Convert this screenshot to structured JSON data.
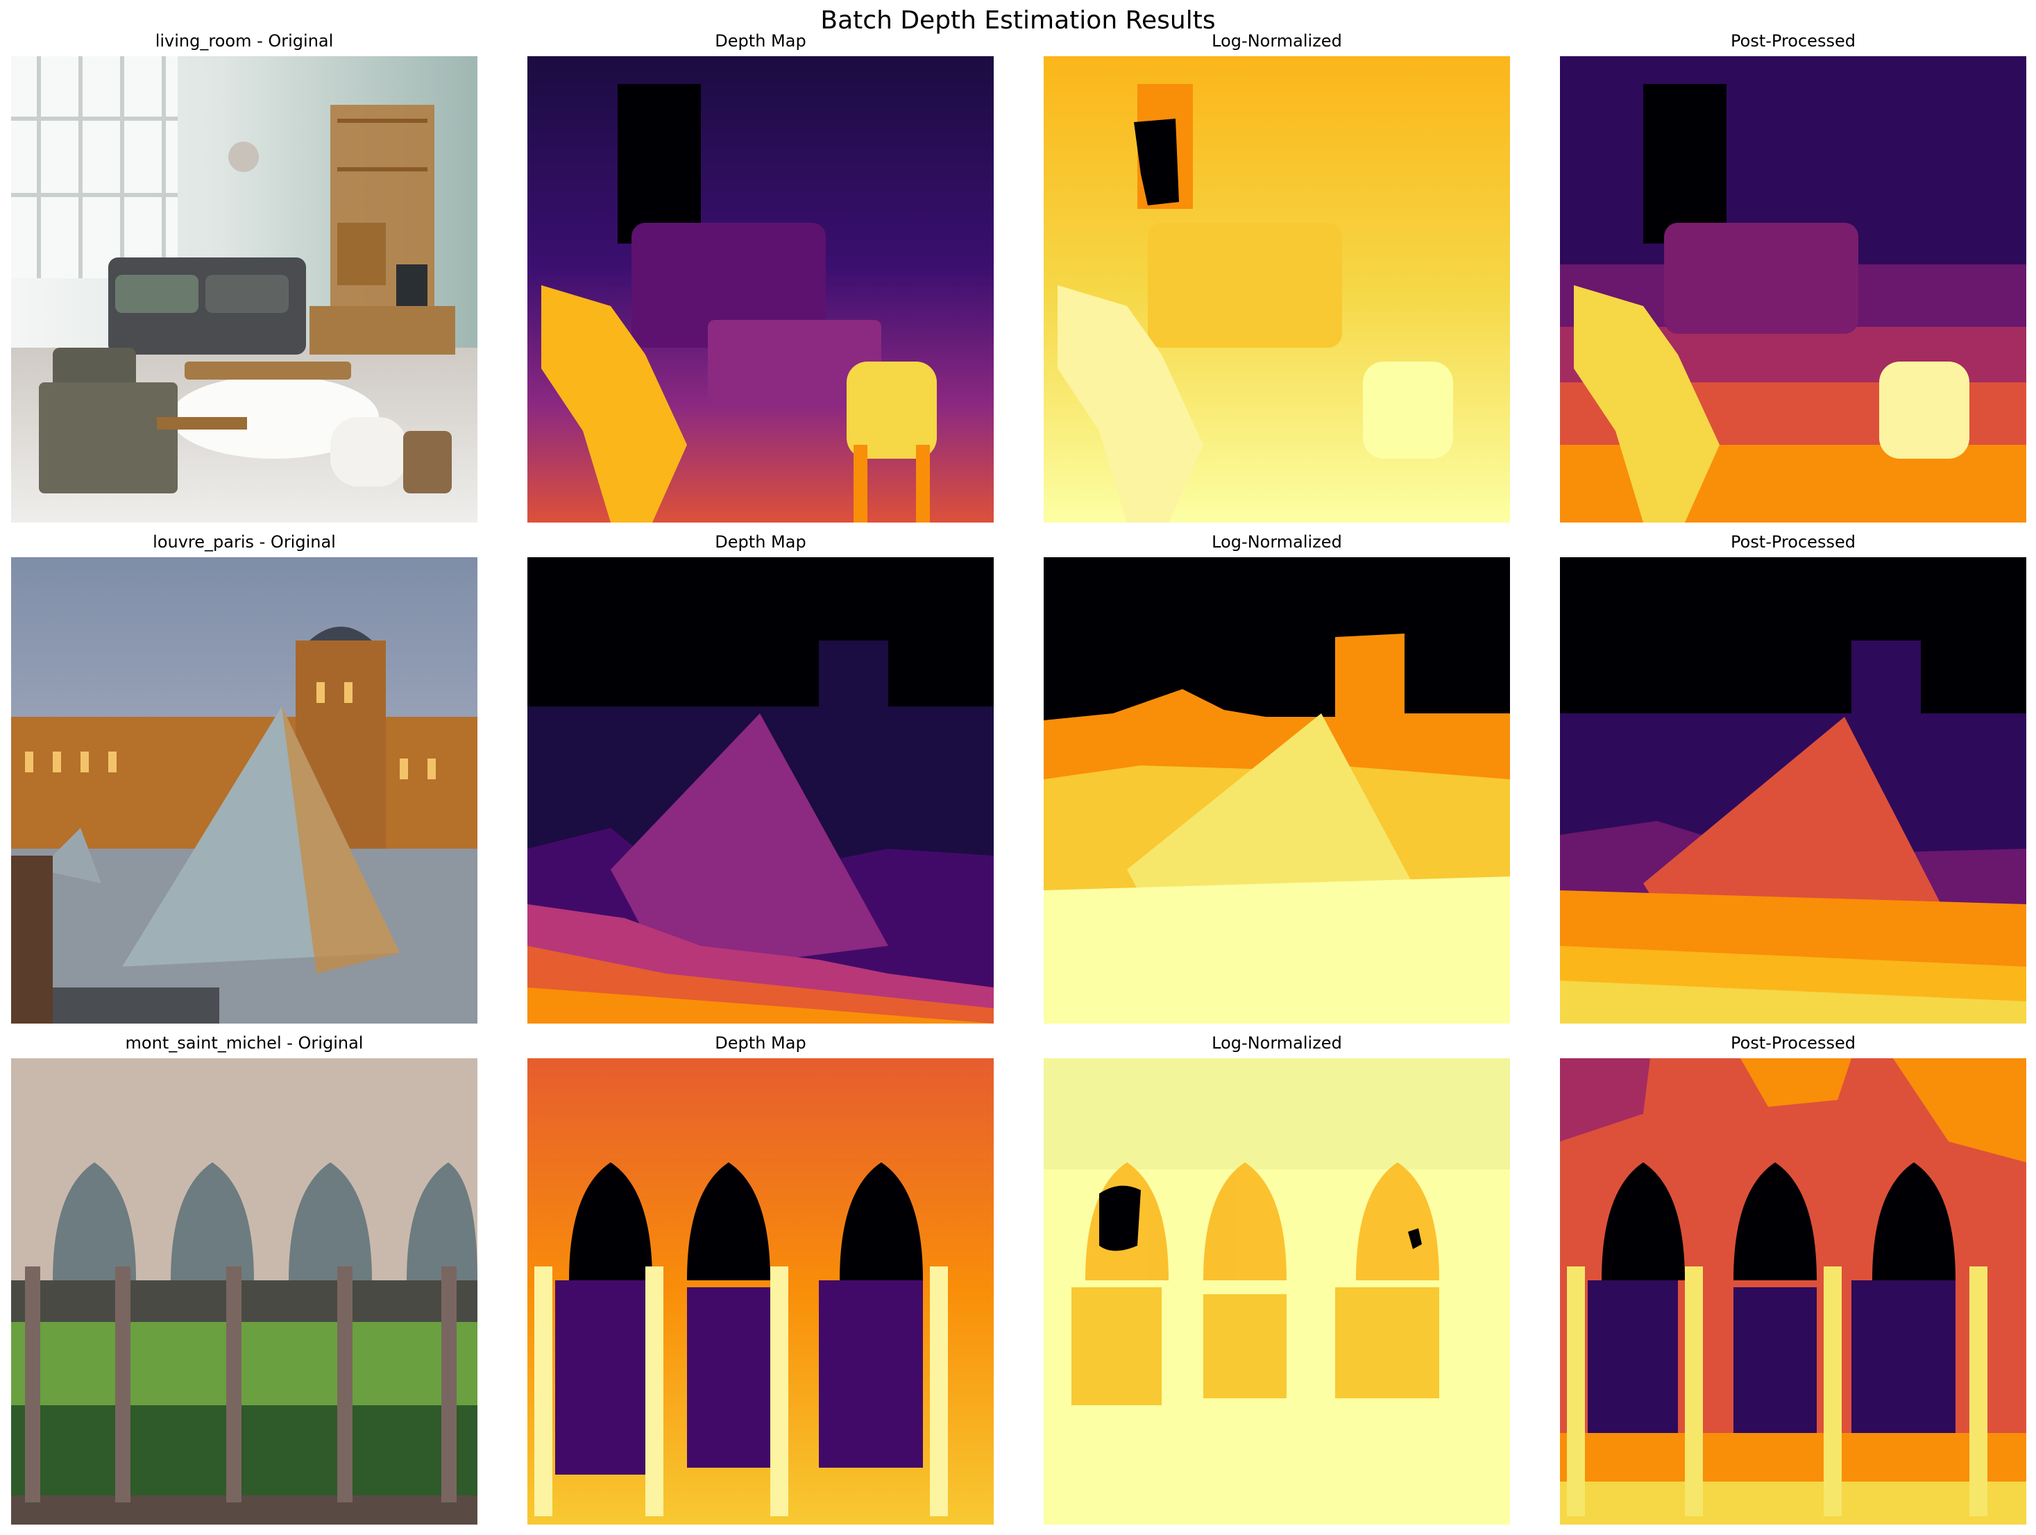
{
  "figure": {
    "title": "Batch Depth Estimation Results"
  },
  "rows": [
    {
      "panels": [
        {
          "title": "living_room - Original"
        },
        {
          "title": "Depth Map"
        },
        {
          "title": "Log-Normalized"
        },
        {
          "title": "Post-Processed"
        }
      ]
    },
    {
      "panels": [
        {
          "title": "louvre_paris - Original"
        },
        {
          "title": "Depth Map"
        },
        {
          "title": "Log-Normalized"
        },
        {
          "title": "Post-Processed"
        }
      ]
    },
    {
      "panels": [
        {
          "title": "mont_saint_michel - Original"
        },
        {
          "title": "Depth Map"
        },
        {
          "title": "Log-Normalized"
        },
        {
          "title": "Post-Processed"
        }
      ]
    }
  ],
  "colormap": {
    "name": "inferno",
    "black": "#000004",
    "purple": "#420a68",
    "magenta": "#932667",
    "orange": "#dd513a",
    "amber": "#fca50a",
    "yellow": "#fcffa4"
  }
}
